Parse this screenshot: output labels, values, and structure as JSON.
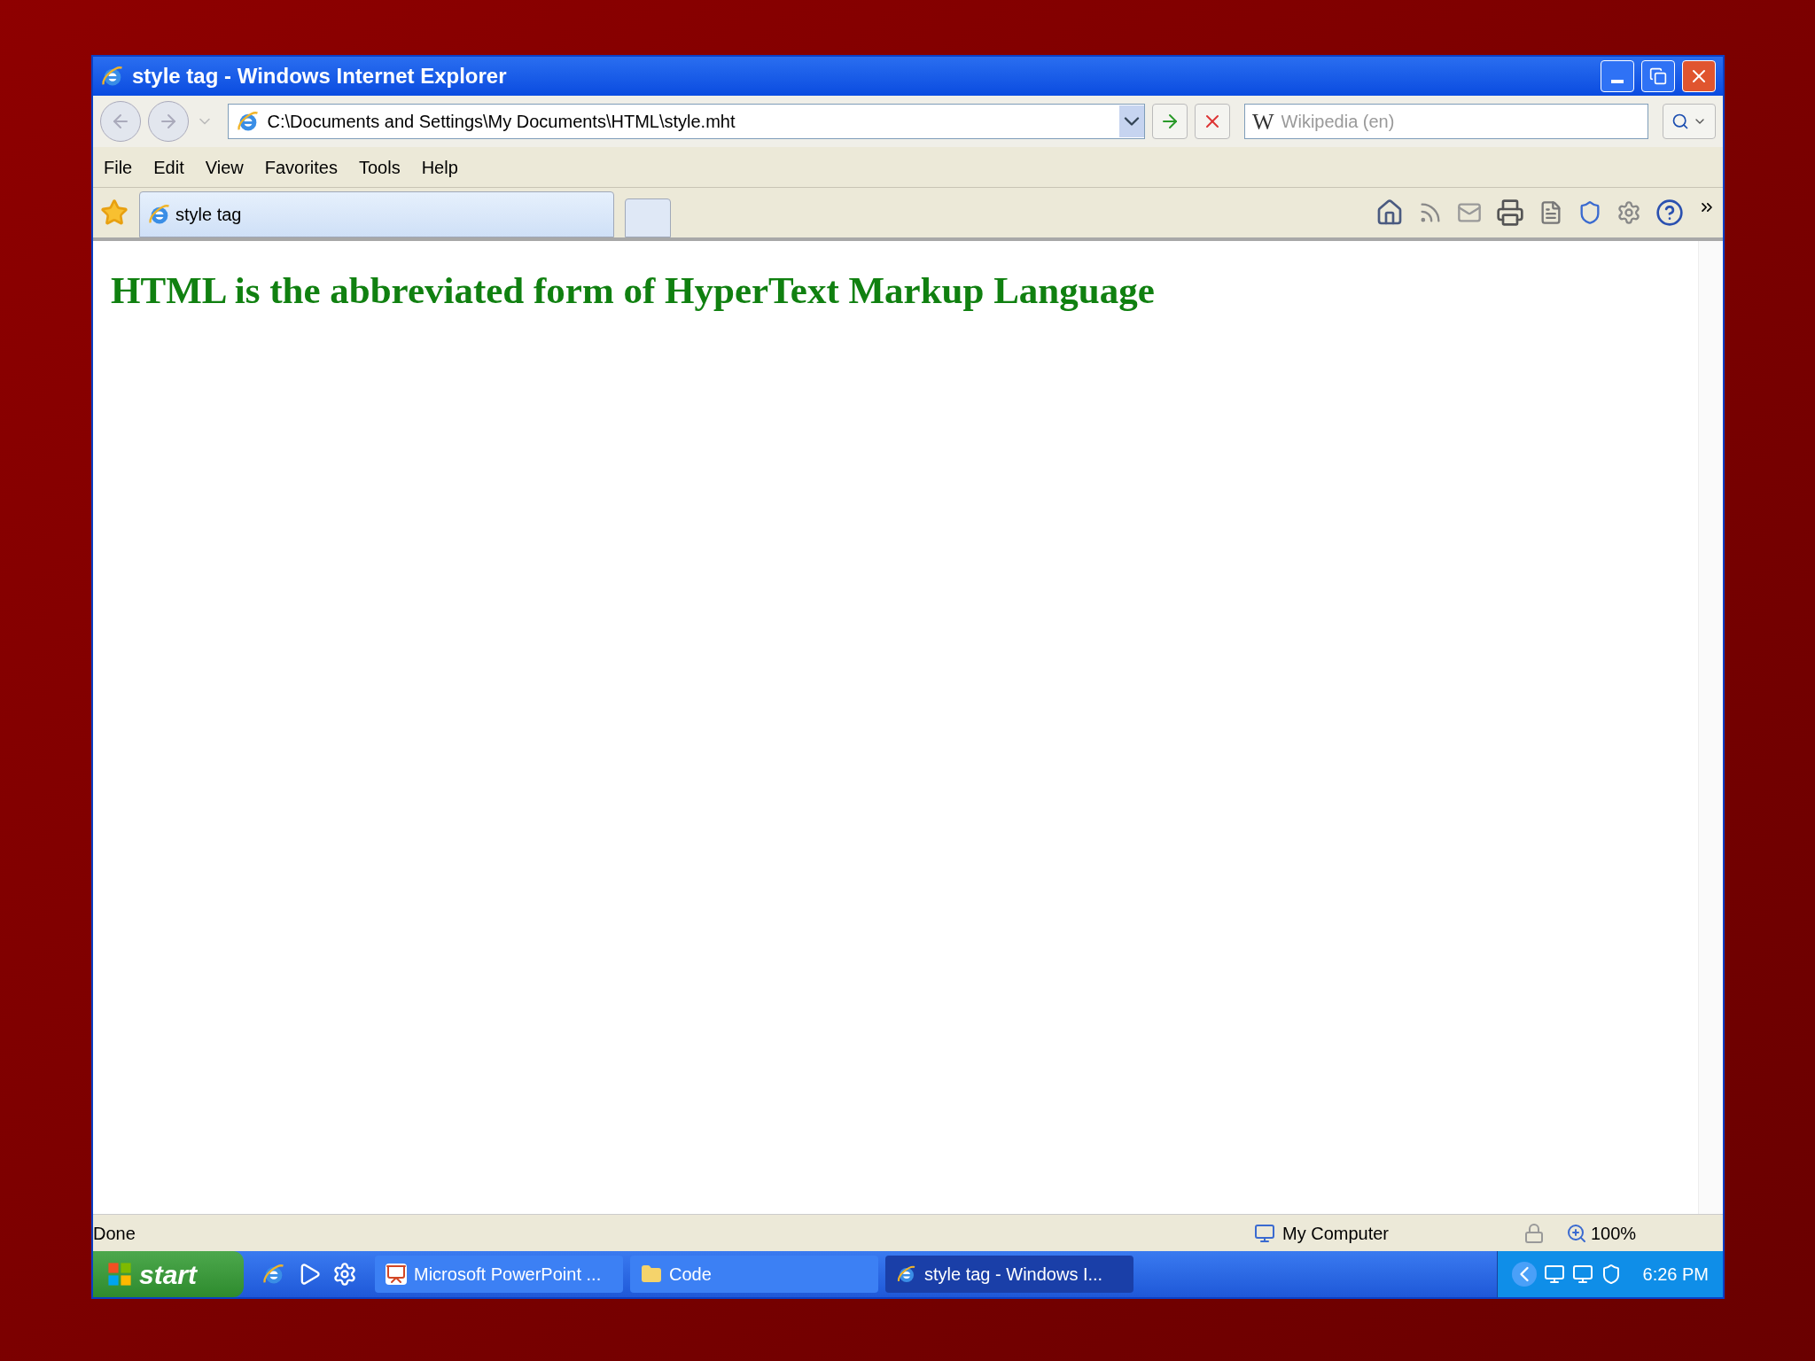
{
  "window": {
    "title": "style tag - Windows Internet Explorer"
  },
  "address": {
    "value": "C:\\Documents and Settings\\My Documents\\HTML\\style.mht"
  },
  "search": {
    "logo": "W",
    "placeholder": "Wikipedia (en)"
  },
  "menu": [
    "File",
    "Edit",
    "View",
    "Favorites",
    "Tools",
    "Help"
  ],
  "tabs": [
    {
      "label": "style tag",
      "selected": true
    }
  ],
  "page": {
    "heading": "HTML is the abbreviated form of HyperText Markup Language"
  },
  "status_bar": {
    "text": "Done",
    "zone": "My Computer",
    "zoom": "100%"
  },
  "taskbar": {
    "start": "start",
    "tasks": [
      {
        "label": "Microsoft PowerPoint ...",
        "kind": "powerpoint",
        "selected": false
      },
      {
        "label": "Code",
        "kind": "folder",
        "selected": false
      },
      {
        "label": "style tag - Windows I...",
        "kind": "browser",
        "selected": true
      }
    ],
    "clock": "6:26 PM"
  }
}
